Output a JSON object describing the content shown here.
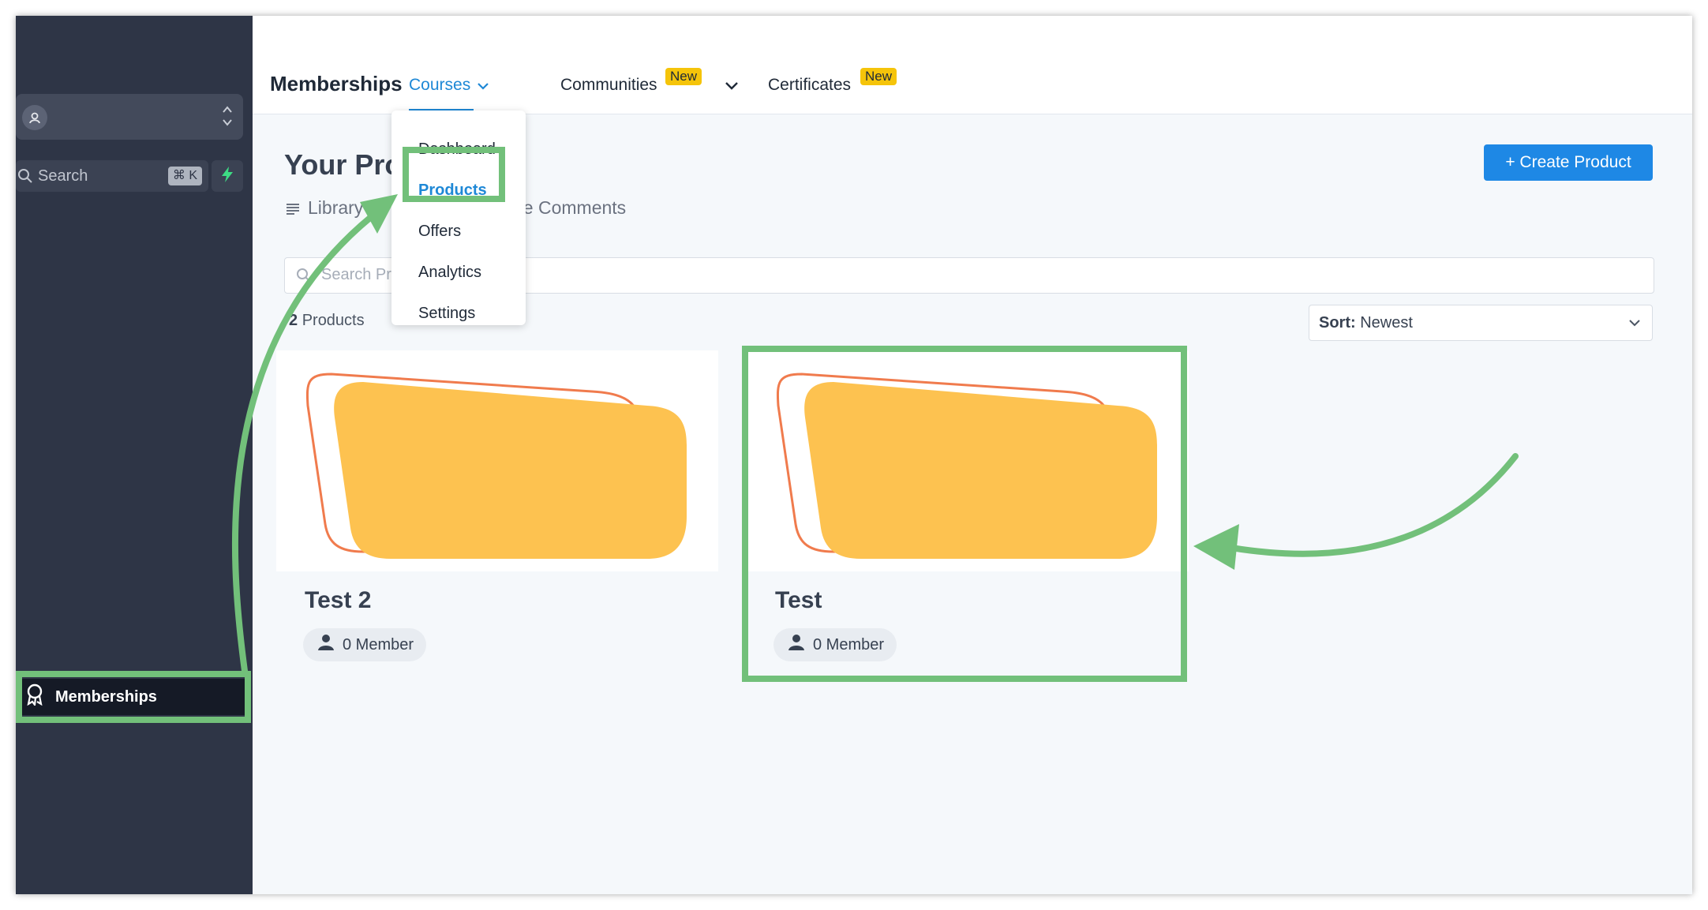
{
  "sidebar": {
    "search_label": "Search",
    "search_shortcut": "⌘ K",
    "nav_memberships": "Memberships"
  },
  "topbar": {
    "app_title": "Memberships",
    "tabs": [
      {
        "label": "Courses"
      },
      {
        "label": "Communities",
        "badge": "New"
      },
      {
        "label": "Certificates",
        "badge": "New"
      }
    ]
  },
  "dropdown": {
    "items": [
      "Dashboard",
      "Products",
      "Offers",
      "Analytics",
      "Settings"
    ]
  },
  "page": {
    "title": "Your Pro",
    "subtab_library": "Library",
    "subtab_comments": "ge Comments",
    "create_button": "+ Create Product",
    "search_placeholder": "Search Pr",
    "count_number": "2",
    "count_label": "Products",
    "sort_label": "Sort:",
    "sort_value": "Newest"
  },
  "products": [
    {
      "name": "Test 2",
      "members": "0 Member"
    },
    {
      "name": "Test",
      "members": "0 Member"
    }
  ],
  "colors": {
    "accent": "#1e88e5",
    "highlight": "#72c07a",
    "badge": "#f5c40a",
    "sidebar": "#2e3546",
    "thumb_fill": "#fdc250",
    "thumb_outline": "#f07b4d"
  }
}
